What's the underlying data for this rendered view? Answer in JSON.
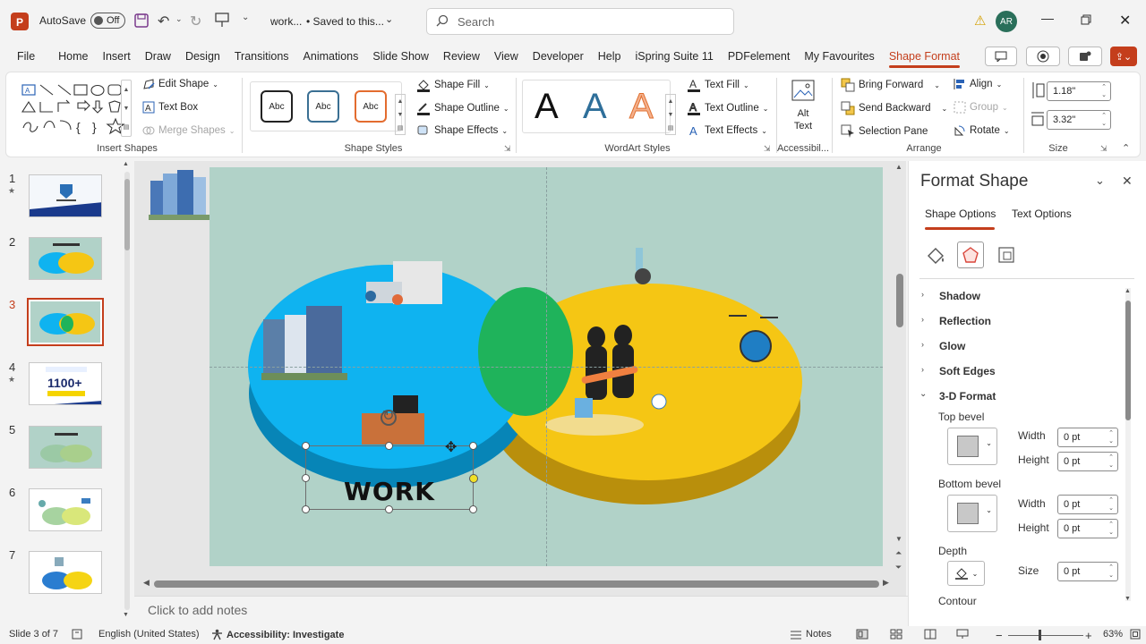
{
  "titlebar": {
    "autosave_label": "AutoSave",
    "autosave_state": "Off",
    "doc_name": "work...",
    "saved_status": "• Saved to this...",
    "search_placeholder": "Search",
    "avatar_initials": "AR"
  },
  "menu": {
    "tabs": [
      "File",
      "Home",
      "Insert",
      "Draw",
      "Design",
      "Transitions",
      "Animations",
      "Slide Show",
      "Review",
      "View",
      "Developer",
      "Help",
      "iSpring Suite 11",
      "PDFelement",
      "My Favourites",
      "Shape Format"
    ],
    "active_tab": "Shape Format"
  },
  "ribbon": {
    "insert_shapes": {
      "label": "Insert Shapes",
      "edit_shape": "Edit Shape",
      "text_box": "Text Box",
      "merge_shapes": "Merge Shapes"
    },
    "shape_styles": {
      "label": "Shape Styles",
      "preview_text": "Abc",
      "fill": "Shape Fill",
      "outline": "Shape Outline",
      "effects": "Shape Effects"
    },
    "wordart": {
      "label": "WordArt Styles",
      "letter": "A",
      "text_fill": "Text Fill",
      "text_outline": "Text Outline",
      "text_effects": "Text Effects"
    },
    "accessibility": {
      "label": "Accessibil...",
      "alt_text_line1": "Alt",
      "alt_text_line2": "Text"
    },
    "arrange": {
      "label": "Arrange",
      "bring_forward": "Bring Forward",
      "send_backward": "Send Backward",
      "selection_pane": "Selection Pane",
      "align": "Align",
      "group": "Group",
      "rotate": "Rotate"
    },
    "size": {
      "label": "Size",
      "height": "1.18\"",
      "width": "3.32\""
    }
  },
  "thumbnails": [
    {
      "num": "1",
      "star": true
    },
    {
      "num": "2",
      "star": false
    },
    {
      "num": "3",
      "star": false,
      "active": true
    },
    {
      "num": "4",
      "star": true,
      "text": "1100+"
    },
    {
      "num": "5",
      "star": false
    },
    {
      "num": "6",
      "star": false
    },
    {
      "num": "7",
      "star": false
    }
  ],
  "slide": {
    "selected_text": "WORK",
    "colors": {
      "blue": "#0fb3f0",
      "yellow": "#f5c614",
      "green": "#1fb35b",
      "background": "#b1d2c8"
    }
  },
  "format_pane": {
    "title": "Format Shape",
    "tabs": [
      "Shape Options",
      "Text Options"
    ],
    "active_tab": "Shape Options",
    "sections": [
      "Shadow",
      "Reflection",
      "Glow",
      "Soft Edges",
      "3-D Format"
    ],
    "top_bevel": "Top bevel",
    "bottom_bevel": "Bottom bevel",
    "width_label": "Width",
    "height_label": "Height",
    "top_width": "0 pt",
    "top_height": "0 pt",
    "bottom_width": "0 pt",
    "bottom_height": "0 pt",
    "depth_label": "Depth",
    "size_label": "Size",
    "depth_size": "0 pt",
    "contour_label": "Contour"
  },
  "notes_placeholder": "Click to add notes",
  "status": {
    "slide_info": "Slide 3 of 7",
    "language": "English (United States)",
    "accessibility": "Accessibility: Investigate",
    "notes": "Notes",
    "zoom": "63%"
  }
}
